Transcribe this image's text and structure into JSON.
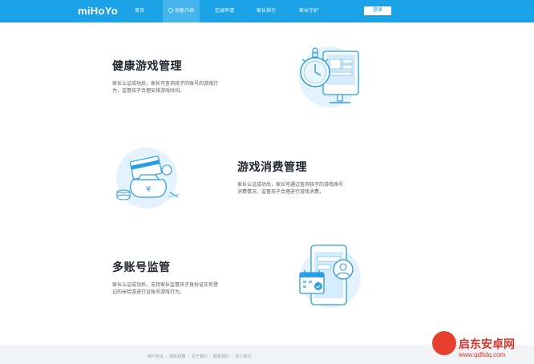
{
  "header": {
    "logo": "miHoYo",
    "nav": [
      "首页",
      "功能介绍",
      "在线申请",
      "家长指引",
      "家长守护"
    ],
    "active_nav": "功能介绍",
    "login": "登录"
  },
  "sections": [
    {
      "title": "健康游戏管理",
      "desc_line1": "家长认证成功后，家长可查询孩子的账号的游戏行",
      "desc_line2": "为，监督孩子合理安排游戏时间。",
      "icon": "stopwatch-monitor-icon"
    },
    {
      "title": "游戏消费管理",
      "desc_line1": "家长认证成功后，家长可通过查询孩子的游戏账号",
      "desc_line2": "消费情况，监督孩子合理进行游戏消费。",
      "icon": "money-bag-icon"
    },
    {
      "title": "多账号监管",
      "desc_line1": "家长认证成功后，支持家长监督孩子身份证实名登",
      "desc_line2": "记的米哈游进行证账号游戏行为。",
      "icon": "phone-calendar-avatar-icon"
    }
  ],
  "footer": {
    "links": [
      "用户协议",
      "隐私政策",
      "关于我们",
      "联系我们",
      "加入我们"
    ]
  },
  "watermark": {
    "name": "启东安卓网",
    "url": "www.qdltdq.com"
  },
  "colors": {
    "header": "#1aa1e6",
    "accent": "#1aa1e6",
    "illustration_bg": "#e3f2fc"
  }
}
